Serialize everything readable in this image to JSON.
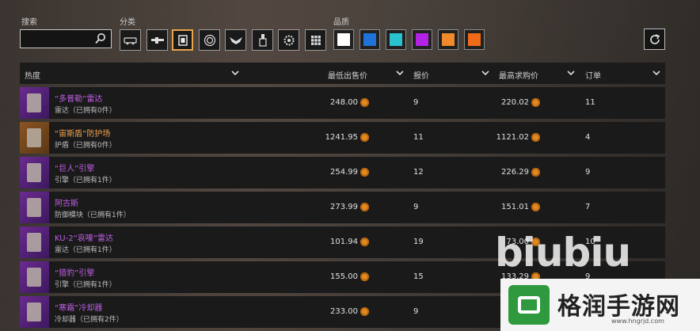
{
  "filters": {
    "search_label": "搜索",
    "search_value": "",
    "category_label": "分类",
    "categories": [
      {
        "icon": "vehicle-icon"
      },
      {
        "icon": "gun-icon"
      },
      {
        "icon": "armor-icon"
      },
      {
        "icon": "wheel-icon"
      },
      {
        "icon": "wing-icon"
      },
      {
        "icon": "tool-icon"
      },
      {
        "icon": "gear-icon"
      },
      {
        "icon": "grid-icon"
      }
    ],
    "quality_label": "品质",
    "qualities": [
      "#ffffff",
      "#1f73d8",
      "#29c3d0",
      "#b323e6",
      "#f08a2a",
      "#f06a17"
    ]
  },
  "table": {
    "headers": {
      "hot": "热度",
      "min_price": "最低出售价",
      "offers": "报价",
      "max_buy": "最高求购价",
      "orders": "订单"
    },
    "rows": [
      {
        "name": "“多普勒”雷达",
        "sub": "雷达（已拥有0件）",
        "rarity": "purple",
        "min_price": "248.00",
        "offers": "9",
        "max_buy": "220.02",
        "orders": "11"
      },
      {
        "name": "“宙斯盾”防护场",
        "sub": "护盾（已拥有0件）",
        "rarity": "orange",
        "min_price": "1241.95",
        "offers": "11",
        "max_buy": "1121.02",
        "orders": "4"
      },
      {
        "name": "“巨人”引擎",
        "sub": "引擎（已拥有1件）",
        "rarity": "purple",
        "min_price": "254.99",
        "offers": "12",
        "max_buy": "226.29",
        "orders": "9"
      },
      {
        "name": "阿古斯",
        "sub": "防御模块（已拥有1件）",
        "rarity": "purple",
        "min_price": "273.99",
        "offers": "9",
        "max_buy": "151.01",
        "orders": "7"
      },
      {
        "name": "KU-2“哀嚎”雷达",
        "sub": "雷达（已拥有1件）",
        "rarity": "purple",
        "min_price": "101.94",
        "offers": "19",
        "max_buy": "73.00",
        "orders": "10"
      },
      {
        "name": "“猎豹”引擎",
        "sub": "引擎（已拥有1件）",
        "rarity": "purple",
        "min_price": "155.00",
        "offers": "15",
        "max_buy": "133.29",
        "orders": "9"
      },
      {
        "name": "“寒霜”冷却器",
        "sub": "冷却器（已拥有2件）",
        "rarity": "purple",
        "min_price": "233.00",
        "offers": "9",
        "max_buy": "",
        "orders": ""
      }
    ]
  },
  "watermark": {
    "brand": "biubiu",
    "site_name": "格润手游网",
    "site_url": "www.hngrjd.com"
  }
}
